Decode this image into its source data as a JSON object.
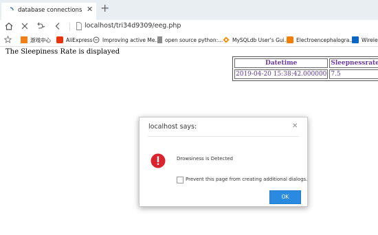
{
  "browser": {
    "tab": {
      "title": "database connections",
      "close_icon": "close-icon"
    },
    "newtab_icon": "plus-icon",
    "url": "localhost/tri34d9309/eeg.php",
    "bookmarks": [
      {
        "label": "游戏中心",
        "icon": "game-center-icon",
        "color": "#f0801a"
      },
      {
        "label": "AliExpress",
        "icon": "aliexpress-icon",
        "color": "#e8340c"
      },
      {
        "label": "Improving active Me...",
        "icon": "page-icon",
        "color": "#555555"
      },
      {
        "label": "open source python:...",
        "icon": "document-icon",
        "color": "#777777"
      },
      {
        "label": "MySQLdb User's Gui...",
        "icon": "diamond-icon",
        "color": "#f08c00"
      },
      {
        "label": "Electroencephalogra...",
        "icon": "blogger-icon",
        "color": "#f57d00"
      },
      {
        "label": "Wireles",
        "icon": "linkedin-icon",
        "color": "#0a66c2"
      }
    ]
  },
  "page": {
    "text": "The Sleepiness Rate is displayed",
    "table": {
      "headers": [
        "Datetime",
        "Sleepnessrate"
      ],
      "rows": [
        [
          "2019-04-20 15:38:42.000000",
          "7.5"
        ]
      ]
    }
  },
  "dialog": {
    "title": "localhost says:",
    "message": "Drowsiness is Detected",
    "checkbox_label": "Prevent this page from creating additional dialogs.",
    "ok_label": "OK",
    "alert_color": "#d9232d",
    "ok_color": "#2a8ae0"
  }
}
